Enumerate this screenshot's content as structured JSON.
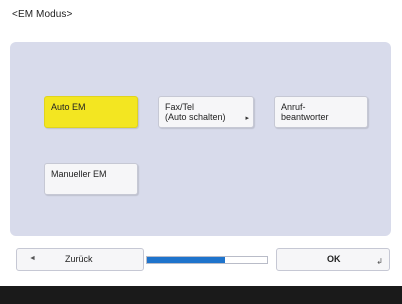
{
  "screen": {
    "title": "<EM Modus>"
  },
  "options": {
    "auto_em": "Auto EM",
    "fax_tel_line1": "Fax/Tel",
    "fax_tel_line2": "(Auto schalten)",
    "anruf_line1": "Anruf-",
    "anruf_line2": "beantworter",
    "manueller_em": "Manueller EM"
  },
  "bottom": {
    "back_label": "Zurück",
    "ok_label": "OK",
    "progress_fraction": 0.65
  },
  "colors": {
    "selected": "#f3e621",
    "panel": "#d8dbeb",
    "progress": "#1f74cc"
  },
  "icons": {
    "submenu": "small-triangle-right",
    "back": "triangle-left",
    "enter": "enter-return-icon"
  }
}
